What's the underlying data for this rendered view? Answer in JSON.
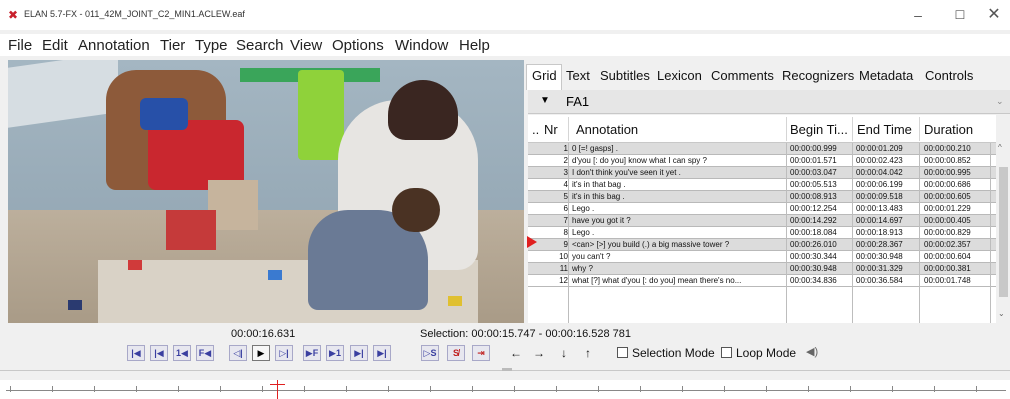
{
  "window": {
    "title": "ELAN 5.7-FX - 011_42M_JOINT_C2_MIN1.ACLEW.eaf",
    "minimize": "–",
    "maximize": "☐",
    "close": "✕"
  },
  "menu": [
    "File",
    "Edit",
    "Annotation",
    "Tier",
    "Type",
    "Search",
    "View",
    "Options",
    "Window",
    "Help"
  ],
  "tabs": [
    "Grid",
    "Text",
    "Subtitles",
    "Lexicon",
    "Comments",
    "Recognizers",
    "Metadata",
    "Controls"
  ],
  "tier": {
    "name": "FA1"
  },
  "grid": {
    "headers": {
      "dots": "..",
      "nr": "Nr",
      "annotation": "Annotation",
      "begin": "Begin Ti...",
      "end": "End Time",
      "duration": "Duration"
    },
    "rows": [
      {
        "nr": "1",
        "annotation": "0 [=! gasps] .",
        "begin": "00:00:00.999",
        "end": "00:00:01.209",
        "duration": "00:00:00.210"
      },
      {
        "nr": "2",
        "annotation": "d'you [: do you] know what I can spy ?",
        "begin": "00:00:01.571",
        "end": "00:00:02.423",
        "duration": "00:00:00.852"
      },
      {
        "nr": "3",
        "annotation": "I don't think you've seen it yet .",
        "begin": "00:00:03.047",
        "end": "00:00:04.042",
        "duration": "00:00:00.995"
      },
      {
        "nr": "4",
        "annotation": "it's in that bag .",
        "begin": "00:00:05.513",
        "end": "00:00:06.199",
        "duration": "00:00:00.686"
      },
      {
        "nr": "5",
        "annotation": "it's in this bag .",
        "begin": "00:00:08.913",
        "end": "00:00:09.518",
        "duration": "00:00:00.605"
      },
      {
        "nr": "6",
        "annotation": "Lego .",
        "begin": "00:00:12.254",
        "end": "00:00:13.483",
        "duration": "00:00:01.229"
      },
      {
        "nr": "7",
        "annotation": "have you got it ?",
        "begin": "00:00:14.292",
        "end": "00:00:14.697",
        "duration": "00:00:00.405"
      },
      {
        "nr": "8",
        "annotation": "Lego .",
        "begin": "00:00:18.084",
        "end": "00:00:18.913",
        "duration": "00:00:00.829"
      },
      {
        "nr": "9",
        "annotation": "<can> [>] you build (.) a big massive tower ?",
        "begin": "00:00:26.010",
        "end": "00:00:28.367",
        "duration": "00:00:02.357"
      },
      {
        "nr": "10",
        "annotation": "you can't ?",
        "begin": "00:00:30.344",
        "end": "00:00:30.948",
        "duration": "00:00:00.604"
      },
      {
        "nr": "11",
        "annotation": "why ?",
        "begin": "00:00:30.948",
        "end": "00:00:31.329",
        "duration": "00:00:00.381"
      },
      {
        "nr": "12",
        "annotation": "what [?] what d'you [: do you] mean there's no...",
        "begin": "00:00:34.836",
        "end": "00:00:36.584",
        "duration": "00:00:01.748"
      }
    ]
  },
  "player": {
    "current_time": "00:00:16.631",
    "selection": "Selection: 00:00:15.747 - 00:00:16.528  781",
    "selection_mode_label": "Selection Mode",
    "loop_mode_label": "Loop Mode",
    "buttons": [
      "|◀",
      "|◀",
      "1◀",
      "F◀",
      "◁|",
      "▶",
      "▷|",
      "▶F",
      "▶1",
      "▶|",
      "▶|"
    ],
    "sel_buttons": [
      "▷S",
      "S̸",
      "⇥"
    ],
    "nav": [
      "←",
      "→",
      "↓",
      "↑"
    ]
  },
  "colors": {
    "accent_red": "#e02020",
    "ctrl_blue": "#3a3fa0"
  }
}
